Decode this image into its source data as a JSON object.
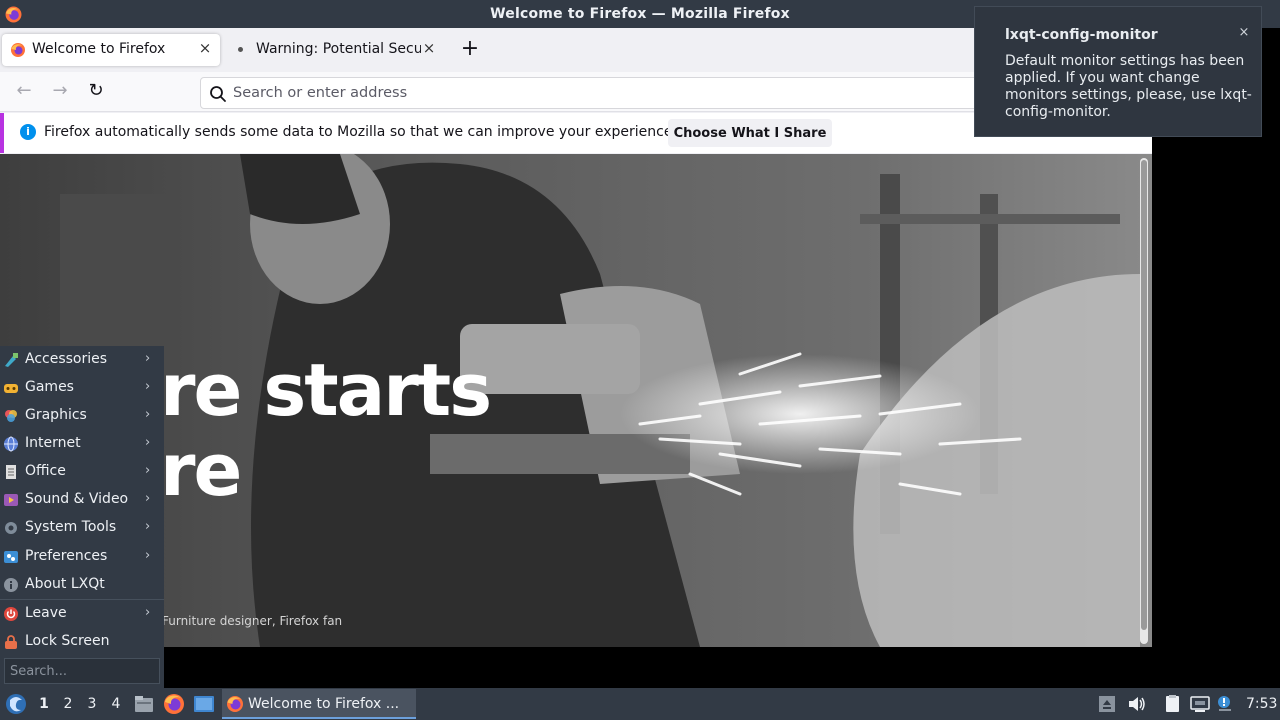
{
  "window": {
    "title": "Welcome to Firefox — Mozilla Firefox"
  },
  "tabs": [
    {
      "label": "Welcome to Firefox",
      "close": "×"
    },
    {
      "label": "Warning: Potential Security Risk Ahead",
      "close": "×"
    }
  ],
  "newtab_label": "+",
  "navbar": {
    "back": "←",
    "forward": "→",
    "reload": "↻",
    "url_placeholder": "Search or enter address"
  },
  "infobar": {
    "icon": "i",
    "text": "Firefox automatically sends some data to Mozilla so that we can improve your experience.",
    "button": "Choose What I Share"
  },
  "hero": {
    "line1": "re starts",
    "line2": "re",
    "caption": "Furniture designer, Firefox fan"
  },
  "notification": {
    "title": "lxqt-config-monitor",
    "body": "Default monitor settings has been applied. If you want change monitors settings, please, use lxqt-config-monitor.",
    "close": "×"
  },
  "menu": {
    "items": [
      {
        "label": "Accessories",
        "icon": "accessories-icon",
        "submenu": true
      },
      {
        "label": "Games",
        "icon": "games-icon",
        "submenu": true
      },
      {
        "label": "Graphics",
        "icon": "graphics-icon",
        "submenu": true
      },
      {
        "label": "Internet",
        "icon": "internet-icon",
        "submenu": true
      },
      {
        "label": "Office",
        "icon": "office-icon",
        "submenu": true
      },
      {
        "label": "Sound & Video",
        "icon": "sound-video-icon",
        "submenu": true
      },
      {
        "label": "System Tools",
        "icon": "system-tools-icon",
        "submenu": true
      },
      {
        "label": "Preferences",
        "icon": "preferences-icon",
        "submenu": true
      },
      {
        "label": "About LXQt",
        "icon": "about-icon",
        "submenu": false
      },
      {
        "label": "Leave",
        "icon": "leave-icon",
        "submenu": true
      },
      {
        "label": "Lock Screen",
        "icon": "lock-icon",
        "submenu": false
      }
    ],
    "arrow": "›",
    "search_placeholder": "Search..."
  },
  "taskbar": {
    "desktops": [
      "1",
      "2",
      "3",
      "4"
    ],
    "active_desktop": "1",
    "task_label": "Welcome to Firefox ...",
    "clock": "7:53"
  }
}
